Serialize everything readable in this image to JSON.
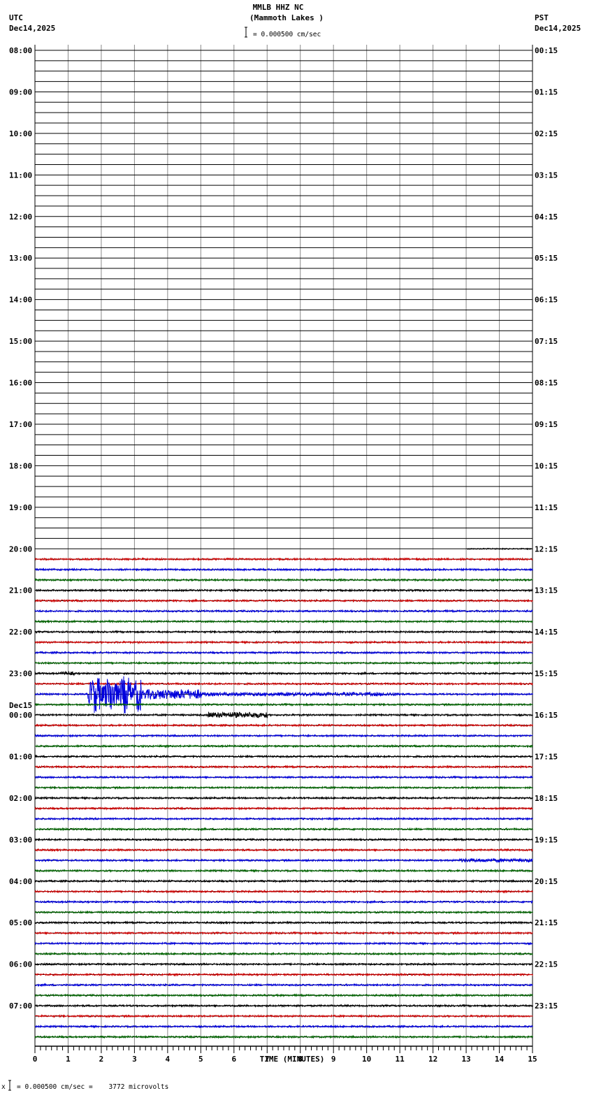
{
  "header": {
    "station": "MMLB HHZ NC",
    "location": "(Mammoth Lakes )",
    "scale": "= 0.000500 cm/sec",
    "left_tz": "UTC",
    "left_date": "Dec14,2025",
    "right_tz": "PST",
    "right_date": "Dec14,2025",
    "next_day_label": "Dec15"
  },
  "footer": {
    "scale_note": "= 0.000500 cm/sec =    3772 microvolts",
    "marker": "x"
  },
  "chart_data": {
    "type": "line",
    "title": "MMLB HHZ NC (Mammoth Lakes )",
    "xlabel": "TIME (MINUTES)",
    "xlim": [
      0,
      15
    ],
    "x_ticks": [
      "0",
      "1",
      "2",
      "3",
      "4",
      "5",
      "6",
      "7",
      "8",
      "9",
      "10",
      "11",
      "12",
      "13",
      "14",
      "15"
    ],
    "rows_per_hour": 4,
    "minutes_per_row": 15,
    "left_hour_labels": [
      "08:00",
      "09:00",
      "10:00",
      "11:00",
      "12:00",
      "13:00",
      "14:00",
      "15:00",
      "16:00",
      "17:00",
      "18:00",
      "19:00",
      "20:00",
      "21:00",
      "22:00",
      "23:00",
      "00:00",
      "01:00",
      "02:00",
      "03:00",
      "04:00",
      "05:00",
      "06:00",
      "07:00"
    ],
    "right_hour_labels": [
      "00:15",
      "01:15",
      "02:15",
      "03:15",
      "04:15",
      "05:15",
      "06:15",
      "07:15",
      "08:15",
      "09:15",
      "10:15",
      "11:15",
      "12:15",
      "13:15",
      "14:15",
      "15:15",
      "16:15",
      "17:15",
      "18:15",
      "19:15",
      "20:15",
      "21:15",
      "22:15",
      "23:15"
    ],
    "total_rows": 96,
    "data_start_row": 48,
    "data_start_minute_first_row": 13,
    "trace_colors": [
      "#000000",
      "#cc0000",
      "#0000dd",
      "#006400"
    ],
    "noise_amplitude": 1.2,
    "events": [
      {
        "row": 48,
        "start": 13.0,
        "end": 15.0,
        "amp": 0.8
      },
      {
        "row": 60,
        "start": 0.8,
        "end": 1.2,
        "amp": 2.5
      },
      {
        "row": 62,
        "start": 1.6,
        "end": 3.2,
        "amp": 28
      },
      {
        "row": 62,
        "start": 3.2,
        "end": 5.0,
        "amp": 7
      },
      {
        "row": 62,
        "start": 5.0,
        "end": 11.0,
        "amp": 2.5
      },
      {
        "row": 64,
        "start": 5.2,
        "end": 7.0,
        "amp": 4
      },
      {
        "row": 78,
        "start": 12.8,
        "end": 15.0,
        "amp": 2.5
      }
    ]
  }
}
